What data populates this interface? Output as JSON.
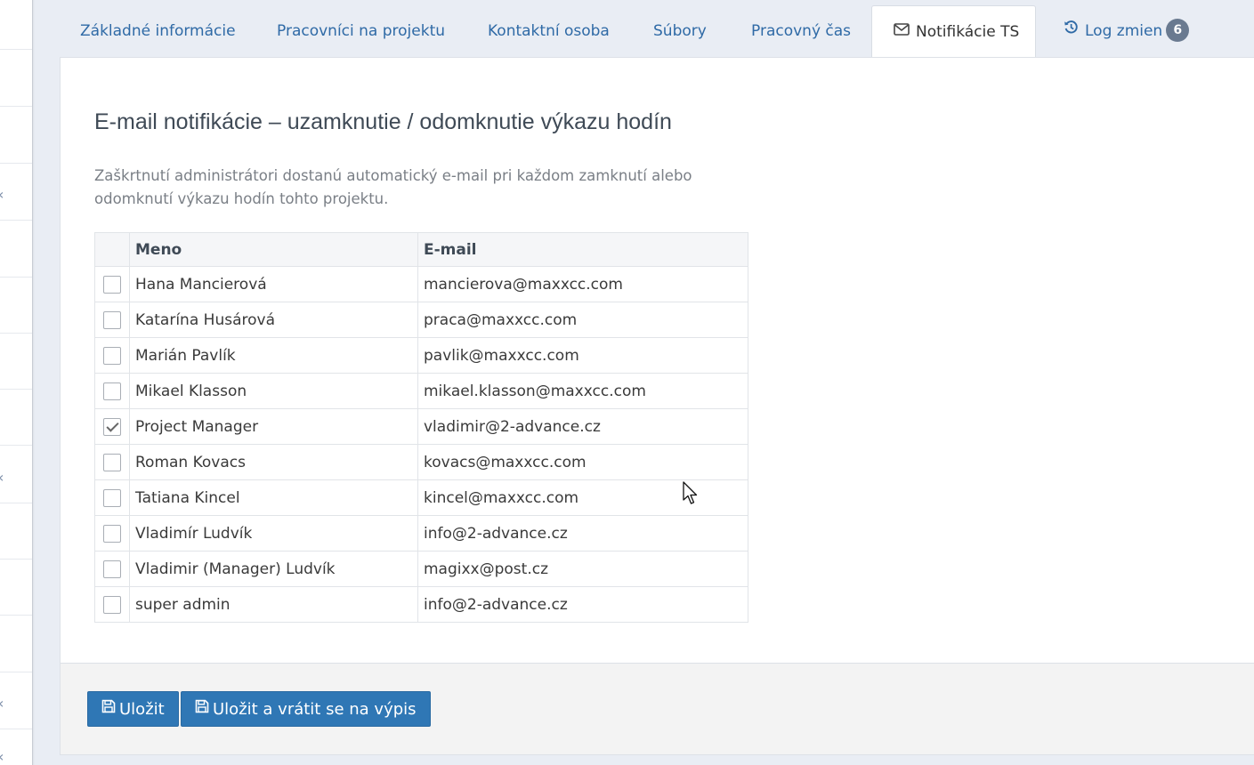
{
  "tabs": [
    {
      "label": "Základné informácie"
    },
    {
      "label": "Pracovníci na projektu"
    },
    {
      "label": "Kontaktní osoba"
    },
    {
      "label": "Súbory"
    },
    {
      "label": "Pracovný čas"
    },
    {
      "label": "Notifikácie TS",
      "icon": "envelope-icon",
      "active": true
    },
    {
      "label": "Log zmien",
      "icon": "history-icon",
      "badge": "6"
    }
  ],
  "main": {
    "heading": "E-mail notifikácie – uzamknutie / odomknutie výkazu hodín",
    "description": "Zaškrtnutí administrátori dostanú automatický e-mail pri každom zamknutí alebo odomknutí výkazu hodín tohto projektu.",
    "table": {
      "headers": [
        "",
        "Meno",
        "E-mail"
      ],
      "rows": [
        {
          "checked": false,
          "name": "Hana Mancierová",
          "email": "mancierova@maxxcc.com"
        },
        {
          "checked": false,
          "name": "Katarína Husárová",
          "email": "praca@maxxcc.com"
        },
        {
          "checked": false,
          "name": "Marián Pavlík",
          "email": "pavlik@maxxcc.com"
        },
        {
          "checked": false,
          "name": "Mikael Klasson",
          "email": "mikael.klasson@maxxcc.com"
        },
        {
          "checked": true,
          "name": "Project Manager",
          "email": "vladimir@2-advance.cz"
        },
        {
          "checked": false,
          "name": "Roman Kovacs",
          "email": "kovacs@maxxcc.com"
        },
        {
          "checked": false,
          "name": "Tatiana Kincel",
          "email": "kincel@maxxcc.com"
        },
        {
          "checked": false,
          "name": "Vladimír Ludvík",
          "email": "info@2-advance.cz"
        },
        {
          "checked": false,
          "name": "Vladimir (Manager) Ludvík",
          "email": "magixx@post.cz"
        },
        {
          "checked": false,
          "name": "super admin",
          "email": "info@2-advance.cz"
        }
      ]
    }
  },
  "footer": {
    "save_label": "Uložit",
    "save_return_label": "Uložit a vrátit se na výpis",
    "button_icon": "floppy-disk-icon"
  },
  "colors": {
    "link": "#2f6aa6",
    "primary_button": "#2f77b5",
    "badge": "#6a7a90",
    "page_background": "#e9edf4"
  }
}
